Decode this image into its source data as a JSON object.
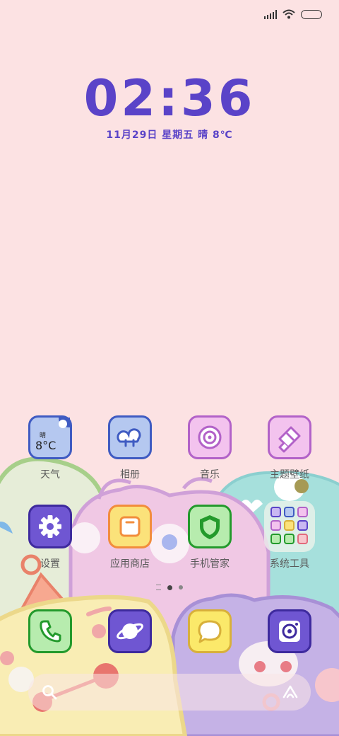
{
  "status_bar": {
    "signal_icon": "signal-icon",
    "wifi_icon": "wifi-icon",
    "battery_icon": "battery-icon"
  },
  "clock": {
    "time": "02:36",
    "date": "11月29日  星期五  晴  8℃"
  },
  "apps": [
    {
      "id": "weather",
      "label": "天气",
      "widget_condition": "晴",
      "widget_temp": "8°C"
    },
    {
      "id": "gallery",
      "label": "相册"
    },
    {
      "id": "music",
      "label": "音乐"
    },
    {
      "id": "themes",
      "label": "主题壁纸"
    },
    {
      "id": "settings",
      "label": "设置"
    },
    {
      "id": "appstore",
      "label": "应用商店"
    },
    {
      "id": "security",
      "label": "手机管家"
    },
    {
      "id": "tools",
      "label": "系统工具"
    }
  ],
  "dock": [
    {
      "id": "phone",
      "icon": "phone-icon"
    },
    {
      "id": "browser",
      "icon": "planet-icon"
    },
    {
      "id": "messages",
      "icon": "message-icon"
    },
    {
      "id": "camera",
      "icon": "camera-icon"
    }
  ],
  "page_indicator": {
    "current": 1,
    "count": 3
  },
  "search_bar": {
    "search_icon": "search-icon",
    "assistant_icon": "assistant-icon"
  },
  "colors": {
    "accent": "#5a43c8",
    "background": "#fce2e3"
  }
}
